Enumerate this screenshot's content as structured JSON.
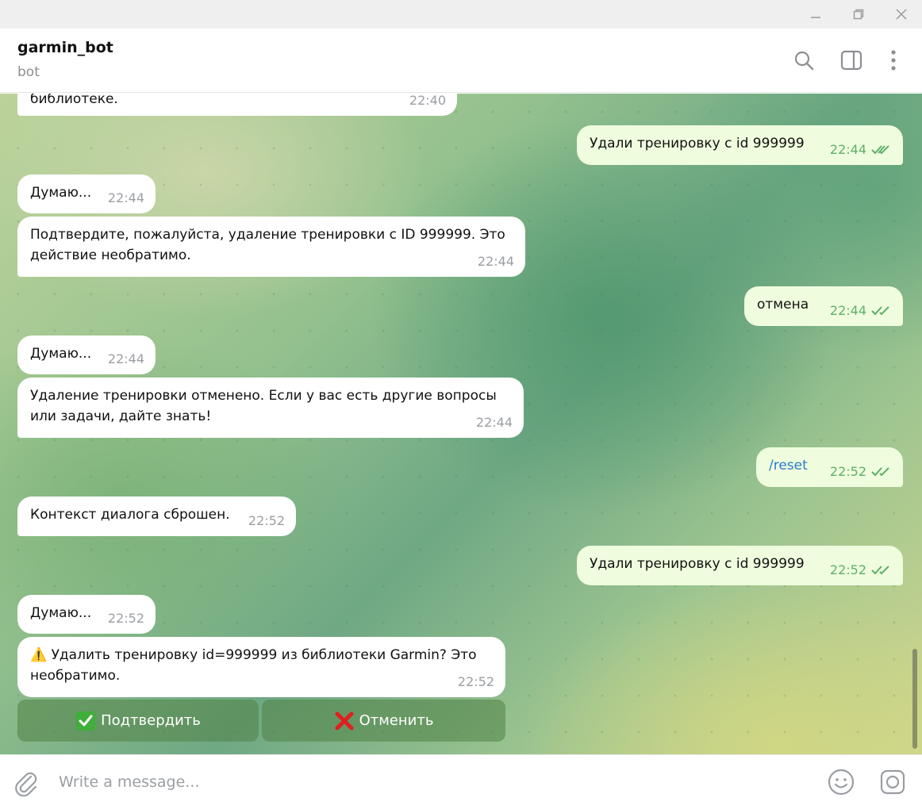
{
  "window": {
    "icons": [
      "minimize-icon",
      "maximize-icon",
      "close-icon"
    ]
  },
  "header": {
    "title": "garmin_bot",
    "subtitle": "bot",
    "icons": [
      "search-icon",
      "sidebar-toggle-icon",
      "more-vertical-icon"
    ]
  },
  "messages": [
    {
      "dir": "in",
      "text": "библиотеке.",
      "time": "22:40"
    },
    {
      "dir": "out",
      "text": "Удали тренировку с id 999999",
      "time": "22:44"
    },
    {
      "dir": "in",
      "text": "Думаю...",
      "time": "22:44"
    },
    {
      "dir": "in",
      "text": "Подтвердите, пожалуйста, удаление тренировки с ID 999999. Это действие необратимо.",
      "time": "22:44"
    },
    {
      "dir": "out",
      "text": "отмена",
      "time": "22:44"
    },
    {
      "dir": "in",
      "text": "Думаю...",
      "time": "22:44"
    },
    {
      "dir": "in",
      "text": "Удаление тренировки отменено. Если у вас есть другие вопросы или задачи, дайте знать!",
      "time": "22:44"
    },
    {
      "dir": "out",
      "text": "/reset",
      "time": "22:52"
    },
    {
      "dir": "in",
      "text": "Контекст диалога сброшен.",
      "time": "22:52"
    },
    {
      "dir": "out",
      "text": "Удали тренировку с id 999999",
      "time": "22:52"
    },
    {
      "dir": "in",
      "text": "Думаю...",
      "time": "22:52"
    },
    {
      "dir": "in",
      "text": "⚠️ Удалить тренировку id=999999 из библиотеки Garmin? Это необратимо.",
      "time": "22:52"
    }
  ],
  "keyboard": {
    "confirm_label": "Подтвердить",
    "cancel_label": "Отменить",
    "confirm_icon": "check-mark-icon",
    "cancel_icon": "cross-mark-icon"
  },
  "composer": {
    "placeholder": "Write a message...",
    "icons": [
      "paperclip-icon",
      "emoji-icon",
      "sticker-icon"
    ]
  },
  "colors": {
    "incoming_bubble": "#ffffff",
    "outgoing_bubble": "#effdde",
    "outgoing_meta": "#5db06a",
    "link": "#2a7bc8",
    "keyboard_button": "#50824699"
  }
}
